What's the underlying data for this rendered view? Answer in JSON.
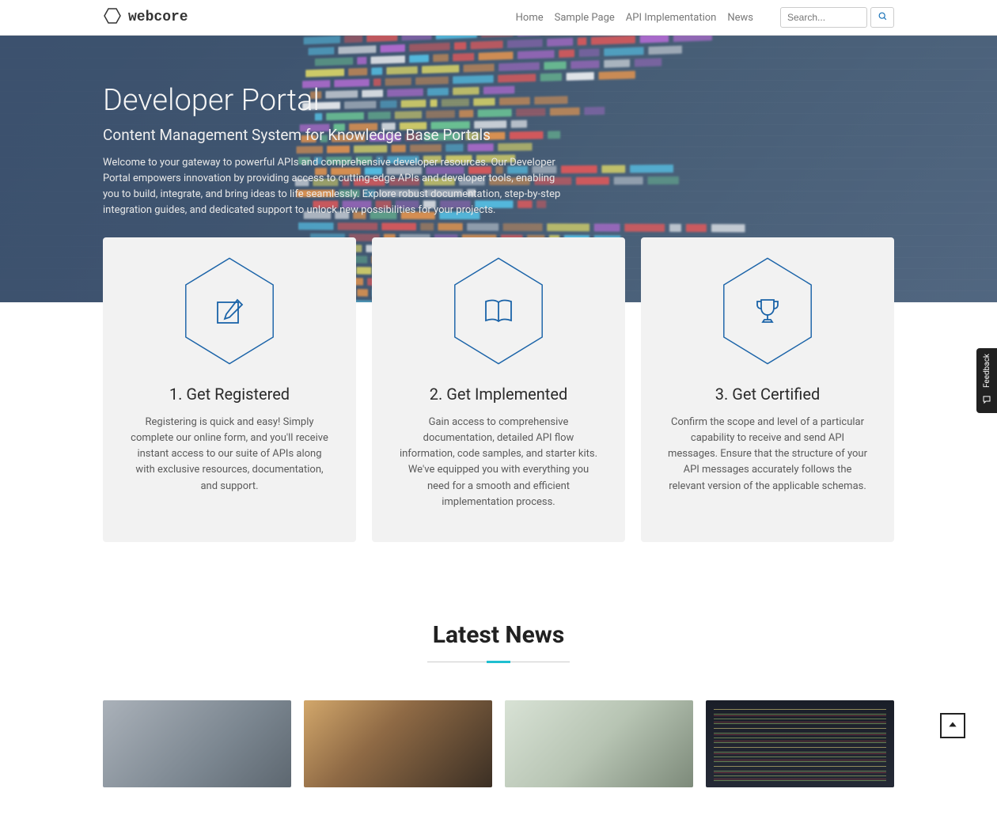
{
  "brand": {
    "name": "webcore"
  },
  "nav": {
    "items": [
      {
        "label": "Home"
      },
      {
        "label": "Sample Page"
      },
      {
        "label": "API Implementation"
      },
      {
        "label": "News"
      }
    ]
  },
  "search": {
    "placeholder": "Search..."
  },
  "hero": {
    "title": "Developer Portal",
    "subtitle": "Content Management System for Knowledge Base Portals",
    "body": "Welcome to your gateway to powerful APIs and comprehensive developer resources. Our Developer Portal empowers innovation by providing access to cutting-edge APIs and developer tools, enabling you to build, integrate, and bring ideas to life seamlessly. Explore robust documentation, step-by-step integration guides, and dedicated support to unlock new possibilities for your projects."
  },
  "cards": [
    {
      "title": "1. Get Registered",
      "body": "Registering is quick and easy! Simply complete our online form, and you'll receive instant access to our suite of APIs along with exclusive resources, documentation, and support."
    },
    {
      "title": "2. Get Implemented",
      "body": "Gain access to comprehensive documentation, detailed API flow information, code samples, and starter kits. We've equipped you with everything you need for a smooth and efficient implementation process."
    },
    {
      "title": "3. Get Certified",
      "body": "Confirm the scope and level of a particular capability to receive and send API messages. Ensure that the structure of your API messages accurately follows the relevant version of the applicable schemas."
    }
  ],
  "news": {
    "heading": "Latest News"
  },
  "feedback": {
    "label": "Feedback"
  }
}
